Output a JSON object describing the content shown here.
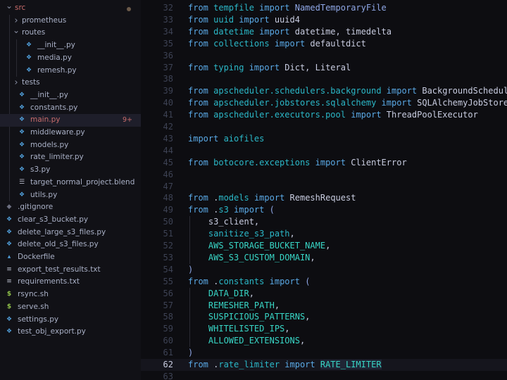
{
  "explorer": {
    "items": [
      {
        "label": "src",
        "type": "folder",
        "expanded": true,
        "depth": 0,
        "color": "#c76b6b",
        "modified": true
      },
      {
        "label": "prometheus",
        "type": "folder",
        "expanded": false,
        "depth": 1
      },
      {
        "label": "routes",
        "type": "folder",
        "expanded": true,
        "depth": 1
      },
      {
        "label": "__init__.py",
        "type": "python",
        "depth": 2
      },
      {
        "label": "media.py",
        "type": "python",
        "depth": 2
      },
      {
        "label": "remesh.py",
        "type": "python",
        "depth": 2
      },
      {
        "label": "tests",
        "type": "folder",
        "expanded": false,
        "depth": 1
      },
      {
        "label": "__init__.py",
        "type": "python",
        "depth": 1
      },
      {
        "label": "constants.py",
        "type": "python",
        "depth": 1
      },
      {
        "label": "main.py",
        "type": "python",
        "depth": 1,
        "selected": true,
        "badge": "9+",
        "color": "#c76b6b"
      },
      {
        "label": "middleware.py",
        "type": "python",
        "depth": 1
      },
      {
        "label": "models.py",
        "type": "python",
        "depth": 1
      },
      {
        "label": "rate_limiter.py",
        "type": "python",
        "depth": 1
      },
      {
        "label": "s3.py",
        "type": "python",
        "depth": 1
      },
      {
        "label": "target_normal_project.blend",
        "type": "blend",
        "depth": 1
      },
      {
        "label": "utils.py",
        "type": "python",
        "depth": 1
      },
      {
        "label": ".gitignore",
        "type": "git",
        "depth": 0
      },
      {
        "label": "clear_s3_bucket.py",
        "type": "python",
        "depth": 0
      },
      {
        "label": "delete_large_s3_files.py",
        "type": "python",
        "depth": 0
      },
      {
        "label": "delete_old_s3_files.py",
        "type": "python",
        "depth": 0
      },
      {
        "label": "Dockerfile",
        "type": "docker",
        "depth": 0
      },
      {
        "label": "export_test_results.txt",
        "type": "text",
        "depth": 0
      },
      {
        "label": "requirements.txt",
        "type": "text",
        "depth": 0
      },
      {
        "label": "rsync.sh",
        "type": "shell",
        "depth": 0
      },
      {
        "label": "serve.sh",
        "type": "shell",
        "depth": 0
      },
      {
        "label": "settings.py",
        "type": "python",
        "depth": 0
      },
      {
        "label": "test_obj_export.py",
        "type": "python",
        "depth": 0
      }
    ]
  },
  "editor": {
    "current_line": 62,
    "lines": [
      {
        "n": "32",
        "tokens": [
          [
            "kw",
            "from "
          ],
          [
            "mod",
            "tempfile"
          ],
          [
            "kw",
            " import "
          ],
          [
            "punc",
            "NamedTemporaryFile"
          ]
        ]
      },
      {
        "n": "33",
        "tokens": [
          [
            "kw",
            "from "
          ],
          [
            "mod",
            "uuid"
          ],
          [
            "kw",
            " import "
          ],
          [
            "name",
            "uuid4"
          ]
        ]
      },
      {
        "n": "34",
        "tokens": [
          [
            "kw",
            "from "
          ],
          [
            "mod",
            "datetime"
          ],
          [
            "kw",
            " import "
          ],
          [
            "name",
            "datetime, timedelta"
          ]
        ]
      },
      {
        "n": "35",
        "tokens": [
          [
            "kw",
            "from "
          ],
          [
            "mod",
            "collections"
          ],
          [
            "kw",
            " import "
          ],
          [
            "name",
            "defaultdict"
          ]
        ]
      },
      {
        "n": "36",
        "tokens": []
      },
      {
        "n": "37",
        "tokens": [
          [
            "kw",
            "from "
          ],
          [
            "mod",
            "typing"
          ],
          [
            "kw",
            " import "
          ],
          [
            "name",
            "Dict, Literal"
          ]
        ]
      },
      {
        "n": "38",
        "tokens": []
      },
      {
        "n": "39",
        "tokens": [
          [
            "kw",
            "from "
          ],
          [
            "mod",
            "apscheduler.schedulers.background"
          ],
          [
            "kw",
            " import "
          ],
          [
            "name",
            "BackgroundScheduler"
          ]
        ]
      },
      {
        "n": "40",
        "tokens": [
          [
            "kw",
            "from "
          ],
          [
            "mod",
            "apscheduler.jobstores.sqlalchemy"
          ],
          [
            "kw",
            " import "
          ],
          [
            "name",
            "SQLAlchemyJobStore"
          ]
        ]
      },
      {
        "n": "41",
        "tokens": [
          [
            "kw",
            "from "
          ],
          [
            "mod",
            "apscheduler.executors.pool"
          ],
          [
            "kw",
            " import "
          ],
          [
            "name",
            "ThreadPoolExecutor"
          ]
        ]
      },
      {
        "n": "42",
        "tokens": []
      },
      {
        "n": "43",
        "tokens": [
          [
            "kw",
            "import "
          ],
          [
            "mod",
            "aiofiles"
          ]
        ]
      },
      {
        "n": "44",
        "tokens": []
      },
      {
        "n": "45",
        "tokens": [
          [
            "kw",
            "from "
          ],
          [
            "mod",
            "botocore.exceptions"
          ],
          [
            "kw",
            " import "
          ],
          [
            "name",
            "ClientError"
          ]
        ]
      },
      {
        "n": "46",
        "tokens": []
      },
      {
        "n": "47",
        "tokens": []
      },
      {
        "n": "48",
        "tokens": [
          [
            "kw",
            "from "
          ],
          [
            "name",
            "."
          ],
          [
            "mod",
            "models"
          ],
          [
            "kw",
            " import "
          ],
          [
            "name",
            "RemeshRequest"
          ]
        ]
      },
      {
        "n": "49",
        "tokens": [
          [
            "kw",
            "from "
          ],
          [
            "name",
            "."
          ],
          [
            "mod",
            "s3"
          ],
          [
            "kw",
            " import "
          ],
          [
            "punc",
            "("
          ]
        ]
      },
      {
        "n": "50",
        "tokens": [
          [
            "name",
            "    s3_client,"
          ]
        ]
      },
      {
        "n": "51",
        "tokens": [
          [
            "mod",
            "    sanitize_s3_path"
          ],
          [
            "name",
            ","
          ]
        ]
      },
      {
        "n": "52",
        "tokens": [
          [
            "const",
            "    AWS_STORAGE_BUCKET_NAME"
          ],
          [
            "name",
            ","
          ]
        ]
      },
      {
        "n": "53",
        "tokens": [
          [
            "const",
            "    AWS_S3_CUSTOM_DOMAIN"
          ],
          [
            "name",
            ","
          ]
        ]
      },
      {
        "n": "54",
        "tokens": [
          [
            "punc",
            ")"
          ]
        ]
      },
      {
        "n": "55",
        "tokens": [
          [
            "kw",
            "from "
          ],
          [
            "name",
            "."
          ],
          [
            "mod",
            "constants"
          ],
          [
            "kw",
            " import "
          ],
          [
            "punc",
            "("
          ]
        ]
      },
      {
        "n": "56",
        "tokens": [
          [
            "const",
            "    DATA_DIR"
          ],
          [
            "name",
            ","
          ]
        ]
      },
      {
        "n": "57",
        "tokens": [
          [
            "const",
            "    REMESHER_PATH"
          ],
          [
            "name",
            ","
          ]
        ]
      },
      {
        "n": "58",
        "tokens": [
          [
            "const",
            "    SUSPICIOUS_PATTERNS"
          ],
          [
            "name",
            ","
          ]
        ]
      },
      {
        "n": "59",
        "tokens": [
          [
            "const",
            "    WHITELISTED_IPS"
          ],
          [
            "name",
            ","
          ]
        ]
      },
      {
        "n": "60",
        "tokens": [
          [
            "const",
            "    ALLOWED_EXTENSIONS"
          ],
          [
            "name",
            ","
          ]
        ]
      },
      {
        "n": "61",
        "tokens": [
          [
            "punc",
            ")"
          ]
        ]
      },
      {
        "n": "62",
        "tokens": [
          [
            "kw",
            "from "
          ],
          [
            "name",
            "."
          ],
          [
            "mod",
            "rate_limiter"
          ],
          [
            "kw",
            " import "
          ],
          [
            "const",
            "RATE_LIMITER",
            "sel"
          ]
        ]
      },
      {
        "n": "63",
        "tokens": []
      }
    ]
  }
}
